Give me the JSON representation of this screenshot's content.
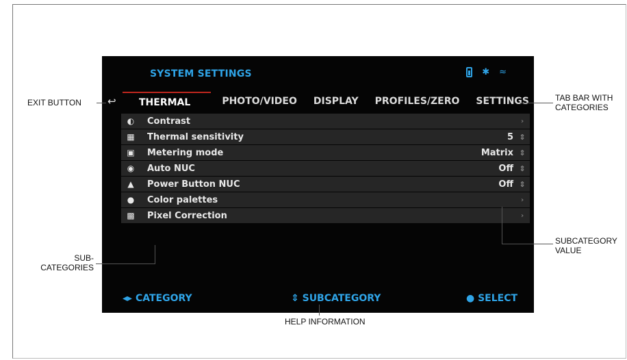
{
  "screen": {
    "title": "SYSTEM SETTINGS",
    "status_icons": [
      "battery-icon",
      "bluetooth-icon",
      "wifi-icon"
    ],
    "tabs": [
      {
        "label": "THERMAL",
        "active": true
      },
      {
        "label": "PHOTO/VIDEO",
        "active": false
      },
      {
        "label": "DISPLAY",
        "active": false
      },
      {
        "label": "PROFILES/ZERO",
        "active": false
      },
      {
        "label": "SETTINGS",
        "active": false
      }
    ],
    "rows": [
      {
        "icon": "contrast-icon",
        "label": "Contrast",
        "value": "",
        "control": "chevron"
      },
      {
        "icon": "sensitivity-icon",
        "label": "Thermal sensitivity",
        "value": "5",
        "control": "spinner"
      },
      {
        "icon": "metering-icon",
        "label": "Metering mode",
        "value": "Matrix",
        "control": "spinner"
      },
      {
        "icon": "eye-icon",
        "label": "Auto NUC",
        "value": "Off",
        "control": "spinner"
      },
      {
        "icon": "brush-icon",
        "label": "Power Button NUC",
        "value": "Off",
        "control": "spinner"
      },
      {
        "icon": "palette-icon",
        "label": "Color palettes",
        "value": "",
        "control": "chevron"
      },
      {
        "icon": "pixel-icon",
        "label": "Pixel Correction",
        "value": "",
        "control": "chevron"
      }
    ],
    "footer": {
      "category": "CATEGORY",
      "subcategory": "SUBCATEGORY",
      "select": "SELECT"
    }
  },
  "callouts": {
    "exit_button": "EXIT BUTTON",
    "tab_bar": "TAB BAR WITH\nCATEGORIES",
    "sub_categories": "SUB-\nCATEGORIES",
    "subcategory_value": "SUBCATEGORY\nVALUE",
    "help_information": "HELP INFORMATION"
  },
  "colors": {
    "accent": "#2fa4e7",
    "active_tab_border": "#c0271e",
    "screen_bg": "#050505",
    "row_bg": "#262626"
  }
}
